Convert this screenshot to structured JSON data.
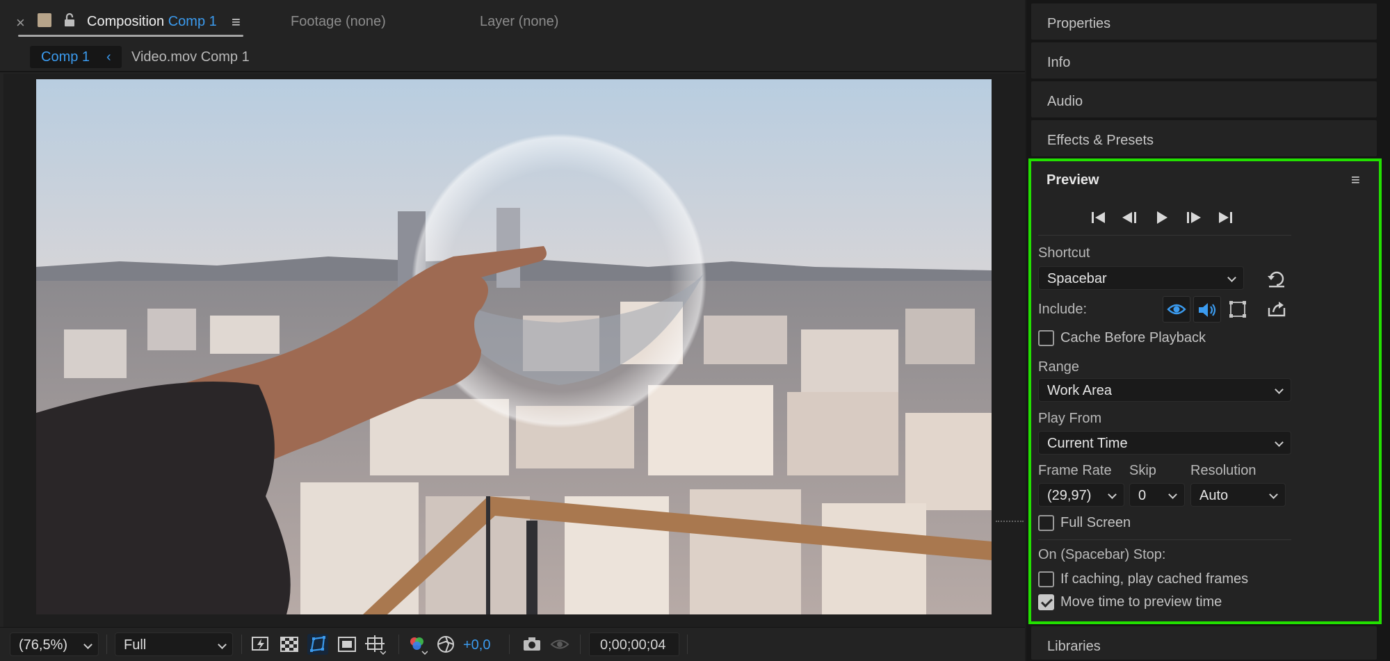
{
  "composition_panel": {
    "close_glyph": "×",
    "tab_prefix": "Composition",
    "tab_name": "Comp 1",
    "menu_glyph": "≡",
    "footage_tab": "Footage (none)",
    "layer_tab": "Layer (none)",
    "breadcrumb_active": "Comp 1",
    "breadcrumb_chevron": "‹",
    "breadcrumb_next": "Video.mov Comp 1"
  },
  "viewer": {
    "content": "city-balcony-pointing-distortion"
  },
  "footer": {
    "zoom": "(76,5%)",
    "resolution": "Full",
    "exposure_offset": "+0,0",
    "timecode": "0;00;00;04",
    "icons": [
      "fast-previews-icon",
      "transparency-grid-icon",
      "mask-path-visibility-icon",
      "region-of-interest-icon",
      "grid-guides-icon",
      "show-channel-icon",
      "color-management-icon",
      "snapshot-icon",
      "show-snapshot-icon"
    ]
  },
  "right_panels": {
    "properties": "Properties",
    "info": "Info",
    "audio": "Audio",
    "effects": "Effects & Presets",
    "libraries": "Libraries"
  },
  "preview": {
    "title": "Preview",
    "menu_glyph": "≡",
    "transport": [
      "first-frame-icon",
      "previous-frame-icon",
      "play-icon",
      "next-frame-icon",
      "last-frame-icon"
    ],
    "shortcut_label": "Shortcut",
    "shortcut_value": "Spacebar",
    "include_label": "Include:",
    "include_video": true,
    "include_audio": true,
    "include_overlays": false,
    "cache_before_playback_label": "Cache Before Playback",
    "cache_before_playback": false,
    "range_label": "Range",
    "range_value": "Work Area",
    "play_from_label": "Play From",
    "play_from_value": "Current Time",
    "frame_rate_label": "Frame Rate",
    "frame_rate_value": "(29,97)",
    "skip_label": "Skip",
    "skip_value": "0",
    "resolution_label": "Resolution",
    "resolution_value": "Auto",
    "full_screen_label": "Full Screen",
    "full_screen": false,
    "on_stop_label": "On (Spacebar) Stop:",
    "if_caching_label": "If caching, play cached frames",
    "if_caching": false,
    "move_time_label": "Move time to preview time",
    "move_time": true
  },
  "colors": {
    "accent_blue": "#3b9bef",
    "highlight_green": "#22e000",
    "panel_bg": "#232323"
  }
}
